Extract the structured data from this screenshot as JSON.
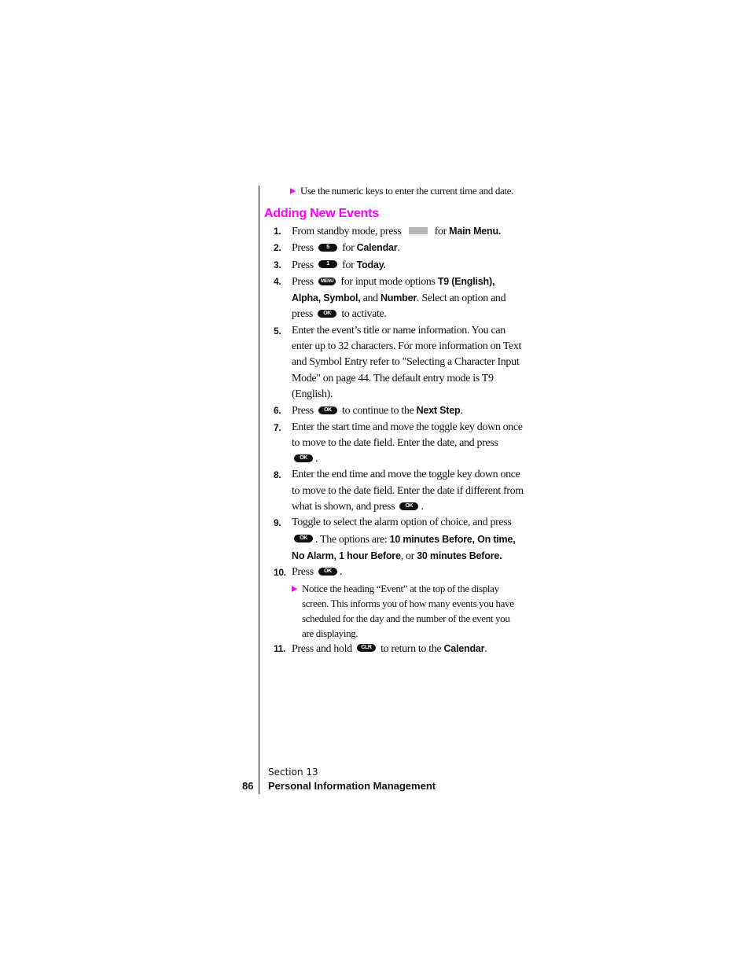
{
  "intro_bullet": "Use the numeric keys to enter the current time and date.",
  "heading": "Adding New Events",
  "accent_color": "#ff00ff",
  "keys": {
    "five": "5",
    "one": "1",
    "menu": "MENU",
    "ok": "OK",
    "clr": "CLR"
  },
  "steps": [
    {
      "num": "1.",
      "a": "From standby mode, press",
      "b": "for",
      "bold": "Main Menu."
    },
    {
      "num": "2.",
      "a": "Press",
      "b": "for",
      "bold": "Calendar",
      "end": "."
    },
    {
      "num": "3.",
      "a": "Press",
      "b": "for",
      "bold": "Today."
    },
    {
      "num": "4.",
      "a": "Press",
      "b": "for input mode options",
      "bold1": "T9 (English),",
      "bold2": "Alpha, Symbol,",
      "c": "and",
      "bold3": "Number",
      "d": ". Select an option and",
      "e": "press",
      "f": "to activate."
    },
    {
      "num": "5.",
      "text": "Enter the event’s title or name information. You can enter up to 32 characters. For more information on Text and Symbol Entry refer to \"Selecting a Character Input Mode\" on page 44. The default entry mode is T9 (English)."
    },
    {
      "num": "6.",
      "a": "Press",
      "b": "to continue to the",
      "bold": "Next Step",
      "end": "."
    },
    {
      "num": "7.",
      "text": "Enter the start time and move the toggle key down once to move to the date field. Enter the date, and press",
      "end": "."
    },
    {
      "num": "8.",
      "text": "Enter the end time and move the toggle key down once to move to the date field. Enter the date if different from what is shown, and press",
      "end": "."
    },
    {
      "num": "9.",
      "text": "Toggle to select the alarm option of choice, and press",
      "b": ". The options are:",
      "bold1": "10 minutes Before, On time, No Alarm, 1 hour Before",
      "c": ", or",
      "bold2": "30 minutes Before."
    },
    {
      "num": "10.",
      "a": "Press",
      "end": ".",
      "note": "Notice the heading “Event” at the top of the display screen. This informs you of how many events you have scheduled for the day and the number of the event you are displaying."
    },
    {
      "num": "11.",
      "a": "Press and hold",
      "b": "to return to the",
      "bold": "Calendar",
      "end": "."
    }
  ],
  "footer": {
    "section": "Section 13",
    "page_number": "86",
    "title": "Personal Information Management"
  }
}
